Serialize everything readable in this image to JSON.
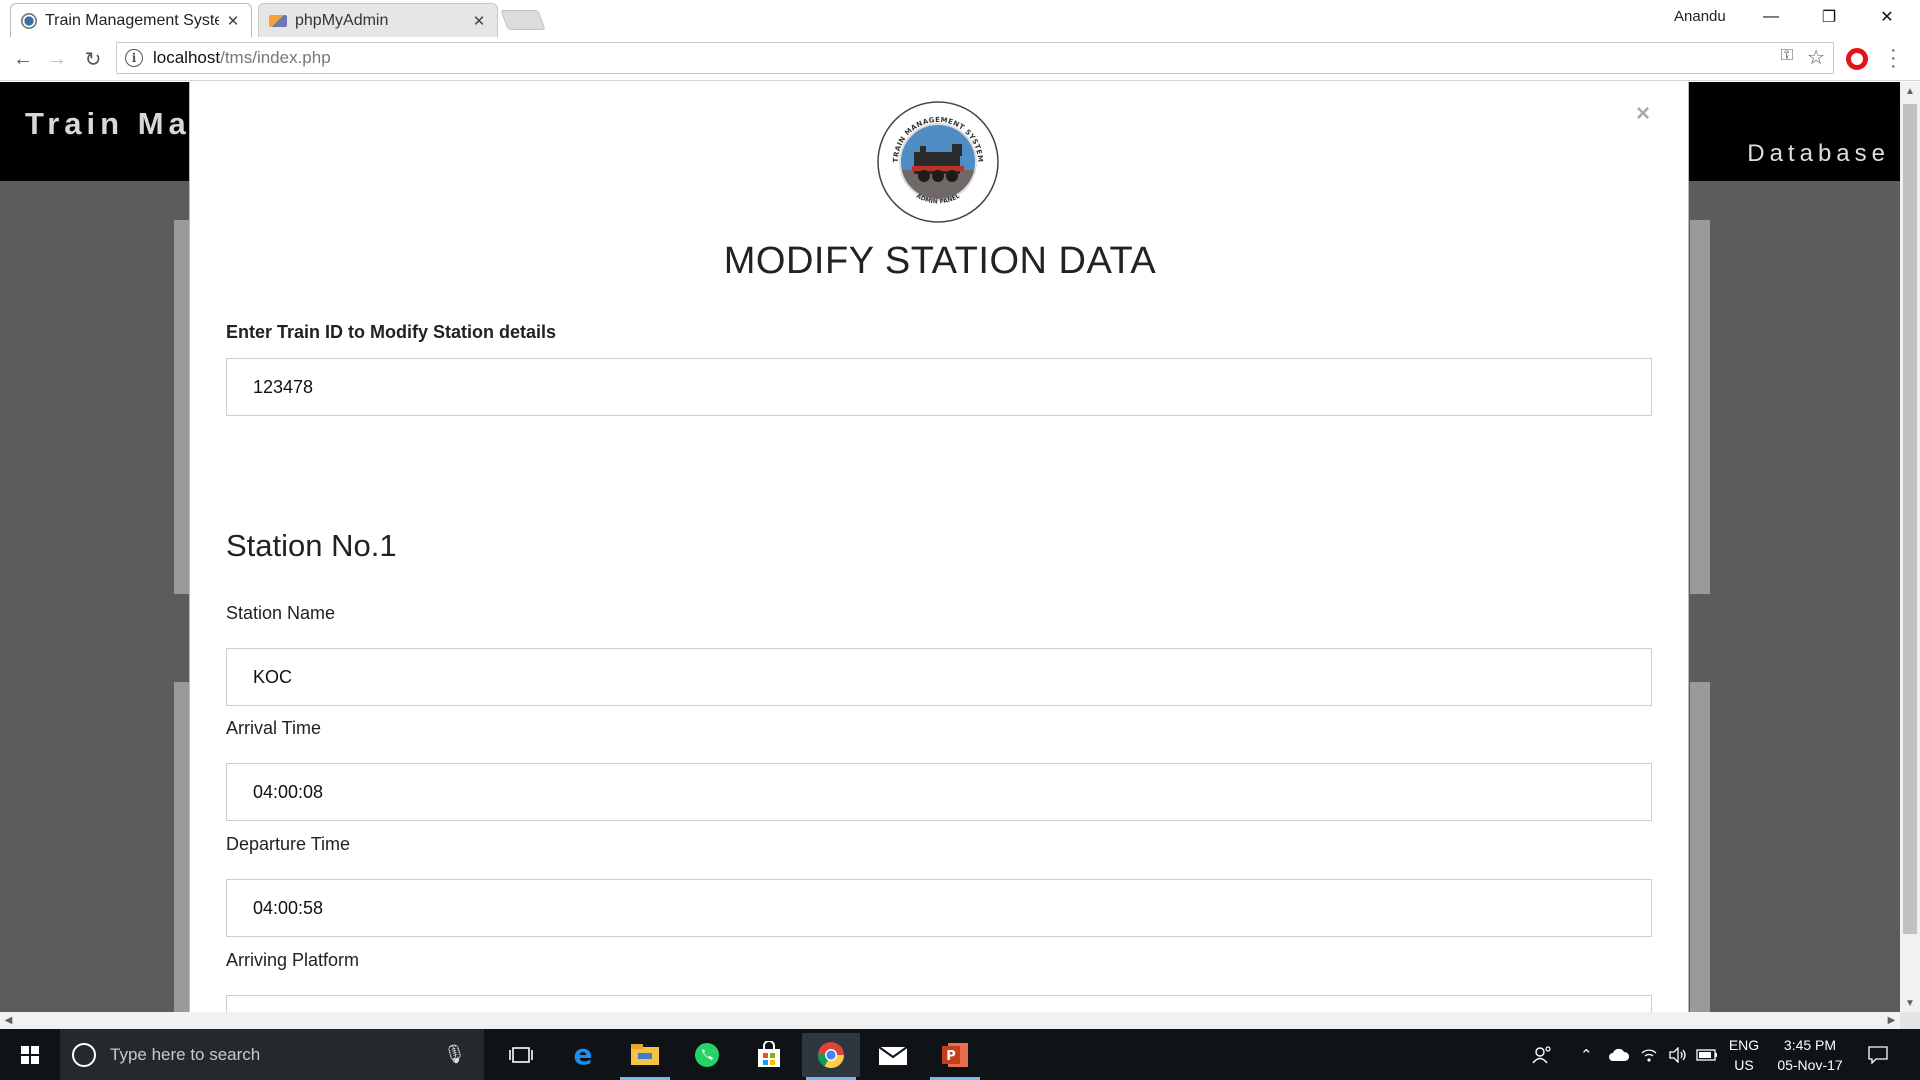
{
  "browser": {
    "tabs": [
      {
        "title": "Train Management Syste",
        "active": true
      },
      {
        "title": "phpMyAdmin",
        "active": false
      }
    ],
    "profile_name": "Anandu",
    "url_host": "localhost",
    "url_path": "/tms/index.php",
    "window_controls": {
      "minimize": "—",
      "restore": "❐",
      "close": "✕"
    }
  },
  "site": {
    "title": "Train Management System",
    "nav_label": "Database"
  },
  "modal": {
    "close_label": "×",
    "logo_text_top": "TRAIN MANAGEMENT SYSTEM",
    "logo_text_bottom": "ADMIN PANEL",
    "title": "MODIFY STATION DATA",
    "train_id_label": "Enter Train ID to Modify Station details",
    "train_id_value": "123478",
    "station_heading": "Station No.1",
    "fields": [
      {
        "label": "Station Name",
        "value": "KOC"
      },
      {
        "label": "Arrival Time",
        "value": "04:00:08"
      },
      {
        "label": "Departure Time",
        "value": "04:00:58"
      },
      {
        "label": "Arriving Platform",
        "value": ""
      }
    ]
  },
  "taskbar": {
    "search_placeholder": "Type here to search",
    "icons": [
      "task-view-icon",
      "edge-icon",
      "file-explorer-icon",
      "whatsapp-icon",
      "store-icon",
      "chrome-icon",
      "mail-icon",
      "powerpoint-icon"
    ],
    "language_top": "ENG",
    "language_bottom": "US",
    "time": "3:45 PM",
    "date": "05-Nov-17"
  },
  "colors": {
    "page_backdrop": "#5c5c5c",
    "header_bg": "#000000",
    "opera_red": "#e3131b",
    "taskbar_bg": "#0f1216"
  }
}
